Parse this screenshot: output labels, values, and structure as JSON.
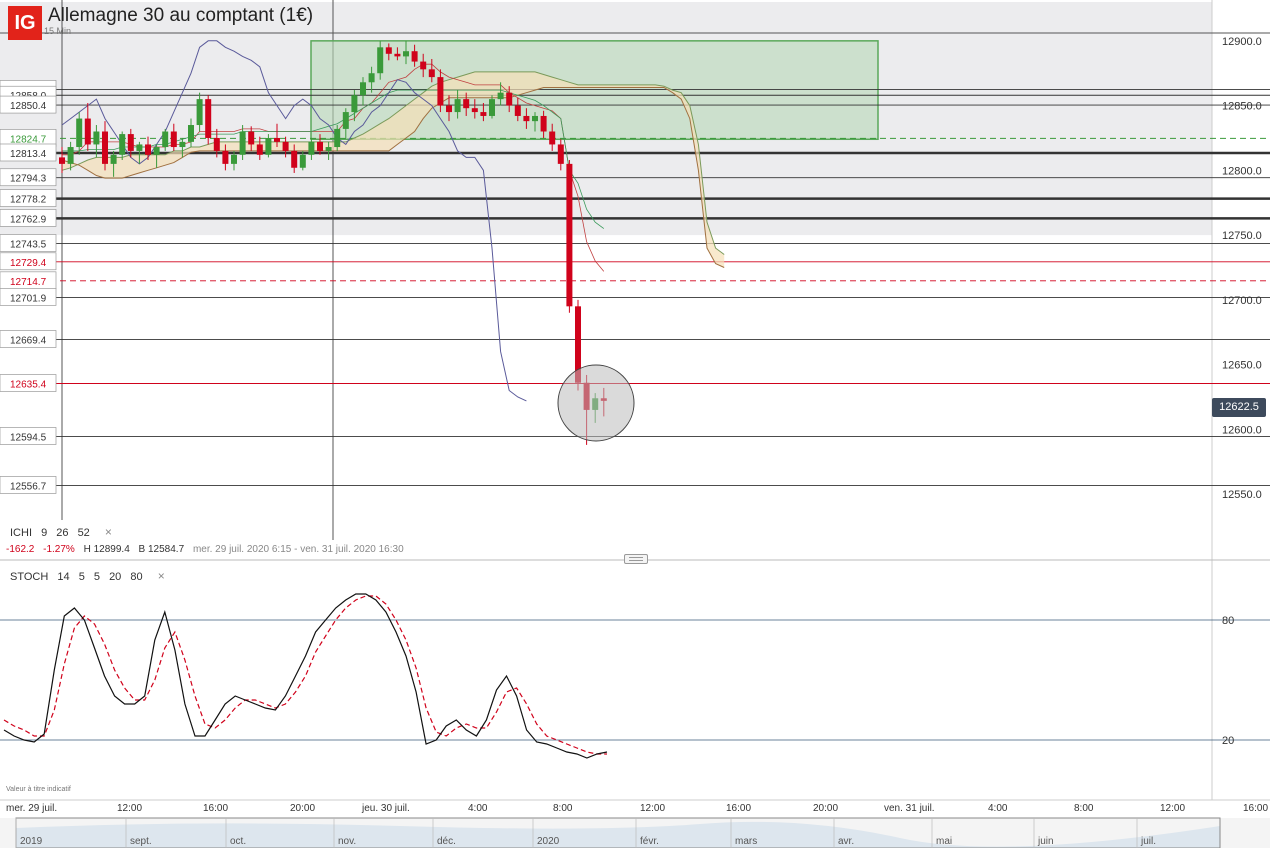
{
  "header": {
    "logo_text": "IG",
    "title": "Allemagne 30 au comptant (1€)",
    "interval": "15 Min"
  },
  "colors": {
    "up": "#3a9a3a",
    "down": "#d0021b",
    "accent_red": "#d0021b",
    "box_fill": "#b8d8b8",
    "badge": "#3d4a5c"
  },
  "chart_data": [
    {
      "type": "candlestick",
      "y_range": [
        12530,
        12930
      ],
      "right_axis_ticks": [
        12900.0,
        12850.0,
        12800.0,
        12750.0,
        12700.0,
        12650.0,
        12600.0,
        12550.0
      ],
      "right_axis_labels": [
        "12900.0",
        "12850.0",
        "12800.0",
        "12750.0",
        "12700.0",
        "12650.0",
        "12600.0",
        "12550.0"
      ],
      "current_price": 12622.5,
      "current_price_label": "12622.5",
      "horizontal_levels": [
        {
          "value": 12862.5,
          "label": "12862.5",
          "color": "#333"
        },
        {
          "value": 12858.0,
          "label": "12858.0",
          "color": "#333"
        },
        {
          "value": 12850.4,
          "label": "12850.4",
          "color": "#333"
        },
        {
          "value": 12824.7,
          "label": "12824.7",
          "color": "#3a9a3a",
          "dashed": true
        },
        {
          "value": 12813.4,
          "label": "12813.4",
          "color": "#333",
          "bold": true
        },
        {
          "value": 12794.3,
          "label": "12794.3",
          "color": "#333"
        },
        {
          "value": 12778.2,
          "label": "12778.2",
          "color": "#333",
          "bold": true
        },
        {
          "value": 12762.9,
          "label": "12762.9",
          "color": "#333",
          "bold": true
        },
        {
          "value": 12743.5,
          "label": "12743.5",
          "color": "#333"
        },
        {
          "value": 12729.4,
          "label": "12729.4",
          "color": "#d0021b"
        },
        {
          "value": 12714.7,
          "label": "12714.7",
          "color": "#d0021b",
          "dashed": true
        },
        {
          "value": 12701.9,
          "label": "12701.9",
          "color": "#333"
        },
        {
          "value": 12669.4,
          "label": "12669.4",
          "color": "#333"
        },
        {
          "value": 12635.4,
          "label": "12635.4",
          "color": "#d0021b"
        },
        {
          "value": 12594.5,
          "label": "12594.5",
          "color": "#333"
        },
        {
          "value": 12556.7,
          "label": "12556.7",
          "color": "#333"
        }
      ],
      "candles": [
        [
          12810,
          12818,
          12798,
          12805
        ],
        [
          12805,
          12822,
          12800,
          12818
        ],
        [
          12818,
          12845,
          12812,
          12840
        ],
        [
          12840,
          12852,
          12815,
          12820
        ],
        [
          12820,
          12835,
          12810,
          12830
        ],
        [
          12830,
          12838,
          12800,
          12805
        ],
        [
          12805,
          12815,
          12795,
          12812
        ],
        [
          12812,
          12830,
          12808,
          12828
        ],
        [
          12828,
          12832,
          12810,
          12815
        ],
        [
          12815,
          12822,
          12805,
          12820
        ],
        [
          12820,
          12826,
          12808,
          12812
        ],
        [
          12812,
          12820,
          12802,
          12818
        ],
        [
          12818,
          12832,
          12815,
          12830
        ],
        [
          12830,
          12836,
          12815,
          12818
        ],
        [
          12818,
          12825,
          12810,
          12822
        ],
        [
          12822,
          12840,
          12818,
          12835
        ],
        [
          12835,
          12860,
          12830,
          12855
        ],
        [
          12855,
          12858,
          12820,
          12825
        ],
        [
          12825,
          12832,
          12810,
          12815
        ],
        [
          12815,
          12820,
          12800,
          12805
        ],
        [
          12805,
          12815,
          12800,
          12812
        ],
        [
          12812,
          12835,
          12808,
          12830
        ],
        [
          12830,
          12834,
          12815,
          12820
        ],
        [
          12820,
          12826,
          12808,
          12812
        ],
        [
          12812,
          12828,
          12810,
          12825
        ],
        [
          12825,
          12836,
          12818,
          12822
        ],
        [
          12822,
          12826,
          12810,
          12815
        ],
        [
          12815,
          12820,
          12798,
          12802
        ],
        [
          12802,
          12815,
          12800,
          12812
        ],
        [
          12812,
          12825,
          12808,
          12822
        ],
        [
          12822,
          12828,
          12812,
          12815
        ],
        [
          12815,
          12822,
          12808,
          12818
        ],
        [
          12818,
          12835,
          12815,
          12832
        ],
        [
          12832,
          12848,
          12825,
          12845
        ],
        [
          12845,
          12862,
          12838,
          12858
        ],
        [
          12858,
          12872,
          12850,
          12868
        ],
        [
          12868,
          12880,
          12860,
          12875
        ],
        [
          12875,
          12900,
          12870,
          12895
        ],
        [
          12895,
          12898,
          12885,
          12890
        ],
        [
          12890,
          12895,
          12885,
          12888
        ],
        [
          12888,
          12900,
          12882,
          12892
        ],
        [
          12892,
          12897,
          12880,
          12884
        ],
        [
          12884,
          12890,
          12872,
          12878
        ],
        [
          12878,
          12886,
          12868,
          12872
        ],
        [
          12872,
          12878,
          12845,
          12850
        ],
        [
          12850,
          12858,
          12838,
          12845
        ],
        [
          12845,
          12862,
          12840,
          12855
        ],
        [
          12855,
          12860,
          12842,
          12848
        ],
        [
          12848,
          12855,
          12840,
          12845
        ],
        [
          12845,
          12852,
          12838,
          12842
        ],
        [
          12842,
          12858,
          12840,
          12855
        ],
        [
          12855,
          12868,
          12850,
          12860
        ],
        [
          12860,
          12865,
          12845,
          12850
        ],
        [
          12850,
          12856,
          12838,
          12842
        ],
        [
          12842,
          12848,
          12832,
          12838
        ],
        [
          12838,
          12845,
          12830,
          12842
        ],
        [
          12842,
          12846,
          12825,
          12830
        ],
        [
          12830,
          12836,
          12815,
          12820
        ],
        [
          12820,
          12824,
          12800,
          12805
        ],
        [
          12805,
          12808,
          12690,
          12695
        ],
        [
          12695,
          12700,
          12630,
          12636
        ],
        [
          12636,
          12642,
          12588,
          12615
        ],
        [
          12615,
          12628,
          12605,
          12624
        ],
        [
          12624,
          12632,
          12610,
          12622
        ]
      ],
      "ichimoku": {
        "params": "ICHI 9 26 52",
        "tenkan": [
          12812,
          12812,
          12815,
          12822,
          12822,
          12822,
          12822,
          12822,
          12820,
          12818,
          12818,
          12818,
          12818,
          12820,
          12820,
          12822,
          12830,
          12830,
          12830,
          12830,
          12830,
          12832,
          12832,
          12832,
          12830,
          12830,
          12830,
          12830,
          12830,
          12830,
          12830,
          12830,
          12830,
          12838,
          12840,
          12848,
          12852,
          12860,
          12868,
          12870,
          12872,
          12878,
          12882,
          12882,
          12876,
          12872,
          12870,
          12868,
          12866,
          12866,
          12866,
          12866,
          12860,
          12856,
          12852,
          12850,
          12848,
          12846,
          12840,
          12800,
          12780,
          12745,
          12730,
          12722
        ],
        "kijun": [
          12815,
          12815,
          12815,
          12816,
          12816,
          12816,
          12816,
          12818,
          12818,
          12818,
          12818,
          12820,
          12820,
          12822,
          12824,
          12826,
          12828,
          12828,
          12828,
          12828,
          12828,
          12830,
          12830,
          12830,
          12830,
          12830,
          12830,
          12830,
          12830,
          12830,
          12832,
          12834,
          12836,
          12840,
          12844,
          12848,
          12852,
          12856,
          12860,
          12862,
          12862,
          12862,
          12862,
          12862,
          12862,
          12862,
          12862,
          12862,
          12862,
          12862,
          12862,
          12862,
          12860,
          12858,
          12856,
          12854,
          12850,
          12845,
          12840,
          12800,
          12790,
          12770,
          12760,
          12755
        ],
        "senkou_a": [
          12800,
          12802,
          12805,
          12808,
          12810,
          12810,
          12810,
          12810,
          12812,
          12812,
          12812,
          12812,
          12812,
          12815,
          12815,
          12818,
          12818,
          12820,
          12822,
          12822,
          12822,
          12822,
          12822,
          12822,
          12822,
          12822,
          12822,
          12822,
          12822,
          12822,
          12822,
          12822,
          12822,
          12822,
          12825,
          12828,
          12832,
          12836,
          12840,
          12845,
          12850,
          12855,
          12860,
          12865,
          12868,
          12870,
          12872,
          12874,
          12876,
          12876,
          12876,
          12876,
          12876,
          12876,
          12876,
          12876,
          12874,
          12872,
          12870,
          12868,
          12866,
          12866,
          12866,
          12866,
          12866,
          12866,
          12866,
          12866,
          12866,
          12866,
          12865,
          12862,
          12860,
          12850,
          12820,
          12760,
          12740,
          12735
        ],
        "senkou_b": [
          12808,
          12806,
          12804,
          12800,
          12796,
          12794,
          12794,
          12794,
          12796,
          12798,
          12800,
          12802,
          12804,
          12806,
          12810,
          12814,
          12815,
          12815,
          12815,
          12815,
          12815,
          12815,
          12815,
          12815,
          12815,
          12815,
          12815,
          12815,
          12815,
          12815,
          12815,
          12815,
          12815,
          12815,
          12815,
          12815,
          12815,
          12815,
          12815,
          12820,
          12825,
          12830,
          12840,
          12848,
          12852,
          12856,
          12856,
          12856,
          12856,
          12856,
          12856,
          12856,
          12856,
          12858,
          12860,
          12862,
          12864,
          12864,
          12864,
          12864,
          12864,
          12864,
          12864,
          12864,
          12864,
          12864,
          12864,
          12864,
          12864,
          12864,
          12864,
          12860,
          12855,
          12840,
          12800,
          12740,
          12728,
          12725
        ],
        "chikou": [
          12835,
          12840,
          12845,
          12850,
          12855,
          12840,
          12830,
          12820,
          12810,
          12805,
          12810,
          12820,
          12830,
          12845,
          12860,
          12875,
          12895,
          12900,
          12900,
          12895,
          12892,
          12888,
          12885,
          12880,
          12860,
          12850,
          12840,
          12850,
          12855,
          12850,
          12840,
          12835,
          12825,
          12820,
          12830,
          12835,
          12845,
          12850,
          12860,
          12870,
          12868,
          12860,
          12855,
          12850,
          12840,
          12830,
          12815,
          12810,
          12810,
          12800,
          12740,
          12660,
          12630,
          12625,
          12622
        ]
      },
      "footer": {
        "change": "-162.2",
        "change_pct": "-1.27%",
        "high": "H 12899.4",
        "low": "B 12584.7",
        "range": "mer. 29 juil. 2020 6:15 - ven. 31 juil. 2020 16:30"
      }
    },
    {
      "type": "line",
      "name": "STOCH 14 5 5 20 80",
      "ylim": [
        0,
        100
      ],
      "levels": [
        80,
        20
      ],
      "level_labels": [
        "80",
        "20"
      ],
      "k": [
        25,
        22,
        20,
        19,
        23,
        55,
        82,
        86,
        80,
        66,
        52,
        42,
        38,
        38,
        42,
        70,
        84,
        65,
        38,
        22,
        22,
        30,
        38,
        42,
        40,
        38,
        36,
        35,
        42,
        52,
        62,
        74,
        80,
        86,
        90,
        93,
        93,
        90,
        84,
        74,
        62,
        44,
        18,
        20,
        27,
        30,
        25,
        22,
        30,
        45,
        52,
        42,
        25,
        19,
        18,
        16,
        14,
        13,
        11,
        13,
        14
      ],
      "d": [
        30,
        27,
        25,
        22,
        22,
        35,
        58,
        76,
        82,
        78,
        68,
        55,
        46,
        40,
        40,
        50,
        66,
        74,
        60,
        42,
        28,
        26,
        30,
        36,
        40,
        40,
        38,
        36,
        38,
        44,
        52,
        64,
        72,
        80,
        86,
        90,
        92,
        92,
        88,
        80,
        70,
        56,
        36,
        24,
        22,
        26,
        28,
        26,
        26,
        34,
        44,
        46,
        38,
        28,
        22,
        20,
        18,
        16,
        14,
        13,
        13
      ]
    }
  ],
  "indicators": {
    "ichi": {
      "label": "ICHI",
      "params": [
        "9",
        "26",
        "52"
      ],
      "close": "×"
    },
    "stoch": {
      "label": "STOCH",
      "params": [
        "14",
        "5",
        "5",
        "20",
        "80"
      ],
      "close": "×"
    }
  },
  "time_axis": {
    "labels": [
      "mer. 29 juil.",
      "12:00",
      "16:00",
      "20:00",
      "jeu. 30 juil.",
      "4:00",
      "8:00",
      "12:00",
      "16:00",
      "20:00",
      "ven. 31 juil.",
      "4:00",
      "8:00",
      "12:00",
      "16:00"
    ]
  },
  "navigator": {
    "labels": [
      "2019",
      "sept.",
      "oct.",
      "nov.",
      "déc.",
      "2020",
      "févr.",
      "mars",
      "avr.",
      "mai",
      "juin",
      "juil."
    ]
  },
  "disclaimer": "Valeur à titre indicatif"
}
